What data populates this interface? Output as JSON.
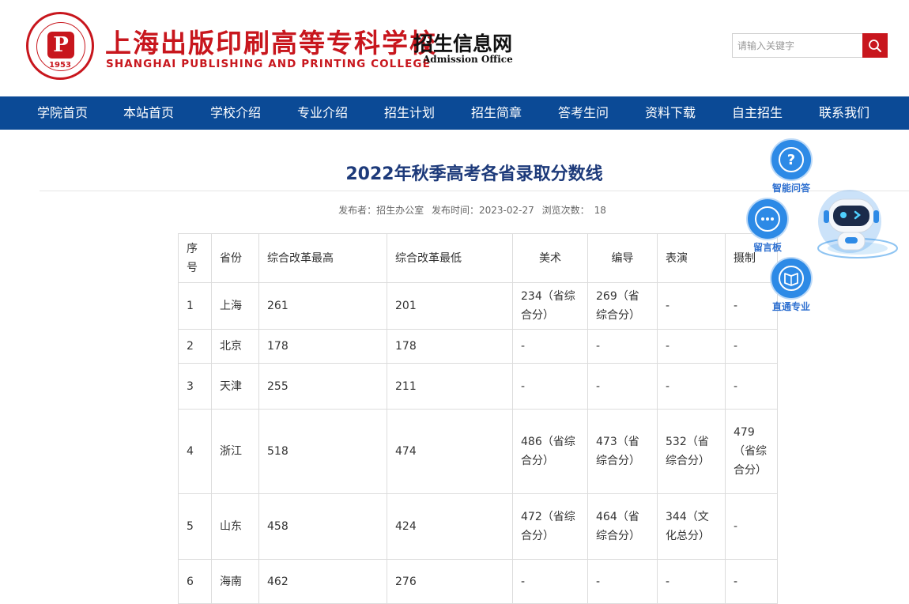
{
  "header": {
    "seal_year": "1953",
    "school_name_cn": "上海出版印刷高等专科学校",
    "school_name_en": "SHANGHAI PUBLISHING AND PRINTING COLLEGE",
    "site_name": "招生信息网",
    "site_sub": "Admission Office",
    "search_placeholder": "请输入关键字"
  },
  "nav": [
    {
      "label": "学院首页"
    },
    {
      "label": "本站首页"
    },
    {
      "label": "学校介绍"
    },
    {
      "label": "专业介绍"
    },
    {
      "label": "招生计划"
    },
    {
      "label": "招生简章"
    },
    {
      "label": "答考生问"
    },
    {
      "label": "资料下载"
    },
    {
      "label": "自主招生"
    },
    {
      "label": "联系我们"
    }
  ],
  "article": {
    "title": "2022年秋季高考各省录取分数线",
    "meta_publisher": "发布者：招生办公室",
    "meta_time": "发布时间：2023-02-27",
    "meta_views_label": "浏览次数：",
    "meta_views": "18"
  },
  "table": {
    "headers": [
      "序号",
      "省份",
      "综合改革最高",
      "综合改革最低",
      "美术",
      "编导",
      "表演",
      "摄制"
    ],
    "rows": [
      [
        "1",
        "上海",
        "261",
        "201",
        "234（省综合分）",
        "269（省综合分）",
        "-",
        "-"
      ],
      [
        "2",
        "北京",
        "178",
        "178",
        "-",
        "-",
        "-",
        "-"
      ],
      [
        "3",
        "天津",
        "255",
        "211",
        "-",
        "-",
        "-",
        "-"
      ],
      [
        "4",
        "浙江",
        "518",
        "474",
        "486（省综合分）",
        "473（省综合分）",
        "532（省综合分）",
        "479（省综合分）"
      ],
      [
        "5",
        "山东",
        "458",
        "424",
        "472（省综合分）",
        "464（省综合分）",
        "344（文化总分）",
        "-"
      ],
      [
        "6",
        "海南",
        "462",
        "276",
        "-",
        "-",
        "-",
        "-"
      ]
    ]
  },
  "float": {
    "qa_label": "智能问答",
    "board_label": "留言板",
    "major_label": "直通专业"
  },
  "colors": {
    "brand_red": "#c8161d",
    "nav_blue": "#0b4a96",
    "title_blue": "#1d3a7a",
    "widget_blue": "#2d8ae6"
  }
}
